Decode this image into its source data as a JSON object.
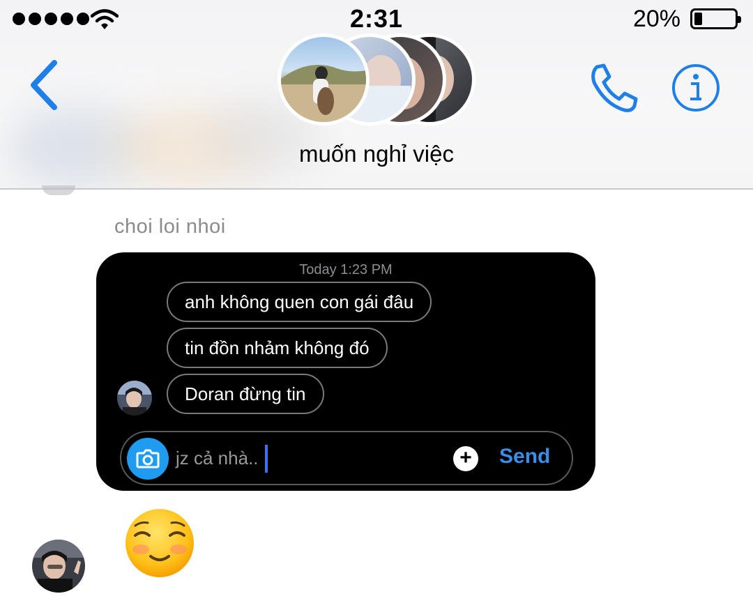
{
  "status_bar": {
    "time": "2:31",
    "battery": "20%",
    "battery_level": 0.2
  },
  "header": {
    "title": "muốn nghỉ việc",
    "icons": {
      "back": "chevron-left-icon",
      "call": "phone-icon",
      "info": "info-icon"
    },
    "accent_color": "#1f7fe8"
  },
  "chat": {
    "sender_name": "choi loi nhoi",
    "shared_card": {
      "timestamp": "Today 1:23 PM",
      "messages": [
        "anh không quen con gái đâu",
        "tin đồn nhảm không đó",
        "Doran đừng tin"
      ],
      "composer": {
        "value": "jz cả nhà..",
        "send_label": "Send",
        "plus_label": "+"
      }
    },
    "reaction_emoji": "smiling-face-with-smiling-eyes"
  }
}
